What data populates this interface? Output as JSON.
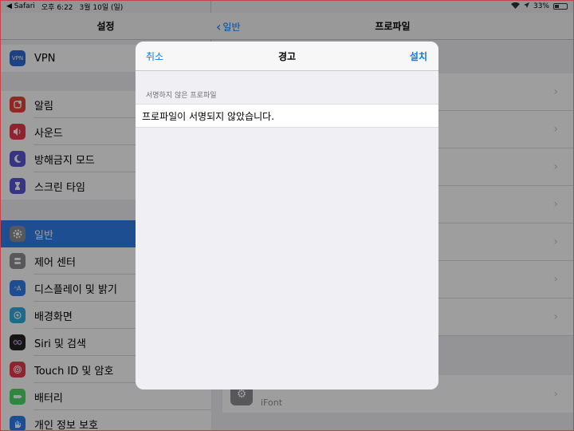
{
  "status_bar": {
    "app_back": "◀ Safari",
    "time": "오후 6:22",
    "date": "3월 10일 (일)",
    "battery": "33%"
  },
  "left_pane": {
    "title": "설정",
    "group1": [
      {
        "label": "VPN",
        "icon": "vpn-icon",
        "icon_text": "VPN",
        "color": "#2f6bd6"
      }
    ],
    "group2": [
      {
        "label": "알림",
        "icon": "notifications-icon",
        "color": "#e8423a"
      },
      {
        "label": "사운드",
        "icon": "sounds-icon",
        "color": "#e8394e"
      },
      {
        "label": "방해금지 모드",
        "icon": "moon-icon",
        "color": "#5b55d6"
      },
      {
        "label": "스크린 타임",
        "icon": "hourglass-icon",
        "color": "#5b55d6"
      }
    ],
    "group3": [
      {
        "label": "일반",
        "icon": "gear-icon",
        "color": "#8e8e93",
        "selected": true
      },
      {
        "label": "제어 센터",
        "icon": "control-center-icon",
        "color": "#8e8e93"
      },
      {
        "label": "디스플레이 및 밝기",
        "icon": "display-brightness-icon",
        "color": "#2e7fea"
      },
      {
        "label": "배경화면",
        "icon": "wallpaper-icon",
        "color": "#35aadc"
      },
      {
        "label": "Siri 및 검색",
        "icon": "siri-icon",
        "color": "#222222"
      },
      {
        "label": "Touch ID 및 암호",
        "icon": "fingerprint-icon",
        "color": "#e8394e"
      },
      {
        "label": "배터리",
        "icon": "battery-setting-icon",
        "color": "#4cd964"
      },
      {
        "label": "개인 정보 보호",
        "icon": "privacy-hand-icon",
        "color": "#2e7fea"
      }
    ]
  },
  "right_pane": {
    "back_label": "일반",
    "title": "프로파일",
    "profile_sub": "iFont"
  },
  "modal": {
    "cancel_label": "취소",
    "title": "경고",
    "install_label": "설치",
    "section_header": "서명하지 않은 프로파일",
    "message": "프로파일이 서명되지 않았습니다."
  }
}
